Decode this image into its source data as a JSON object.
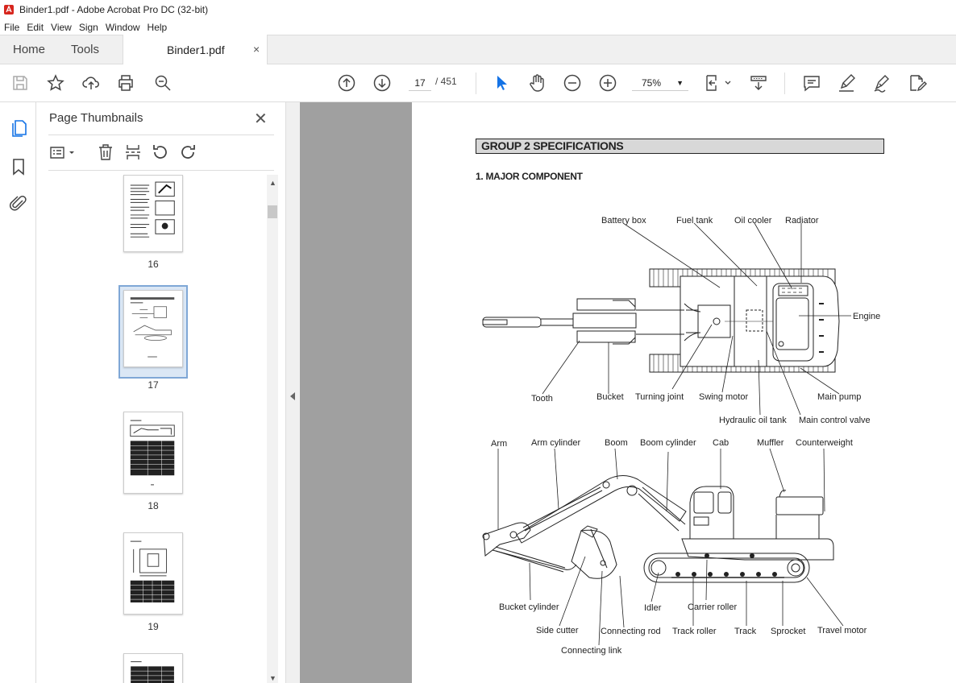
{
  "window": {
    "title": "Binder1.pdf - Adobe Acrobat Pro DC (32-bit)"
  },
  "menu": [
    "File",
    "Edit",
    "View",
    "Sign",
    "Window",
    "Help"
  ],
  "tabs": {
    "home": "Home",
    "tools": "Tools",
    "document": "Binder1.pdf",
    "close": "×"
  },
  "toolbar": {
    "current_page": "17",
    "total_pages": "/ 451",
    "zoom": "75%"
  },
  "panel": {
    "title": "Page Thumbnails",
    "thumbnails": [
      {
        "label": "16"
      },
      {
        "label": "17"
      },
      {
        "label": "18"
      },
      {
        "label": "19"
      }
    ]
  },
  "document": {
    "group_header": "GROUP  2  SPECIFICATIONS",
    "section_title": "1. MAJOR COMPONENT",
    "top_view_labels": {
      "battery_box": "Battery box",
      "fuel_tank": "Fuel tank",
      "oil_cooler": "Oil cooler",
      "radiator": "Radiator",
      "engine": "Engine",
      "tooth": "Tooth",
      "bucket": "Bucket",
      "turning_joint": "Turning joint",
      "swing_motor": "Swing motor",
      "main_pump": "Main pump",
      "hydraulic_oil_tank": "Hydraulic oil tank",
      "main_control_valve": "Main control valve"
    },
    "side_view_labels": {
      "arm": "Arm",
      "arm_cylinder": "Arm cylinder",
      "boom": "Boom",
      "boom_cylinder": "Boom cylinder",
      "cab": "Cab",
      "muffler": "Muffler",
      "counterweight": "Counterweight",
      "bucket_cylinder": "Bucket cylinder",
      "idler": "Idler",
      "carrier_roller": "Carrier roller",
      "side_cutter": "Side cutter",
      "connecting_rod": "Connecting rod",
      "track_roller": "Track roller",
      "track": "Track",
      "sprocket": "Sprocket",
      "travel_motor": "Travel motor",
      "connecting_link": "Connecting link"
    }
  }
}
